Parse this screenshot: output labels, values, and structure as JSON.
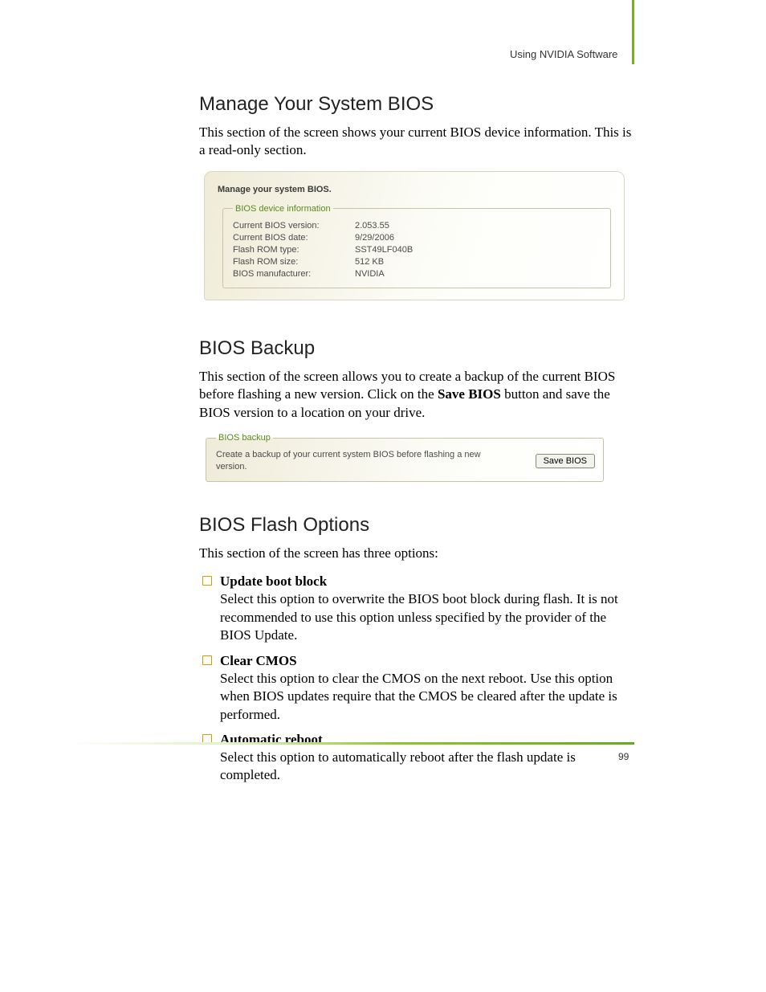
{
  "header": {
    "chapter": "Using NVIDIA Software"
  },
  "sections": {
    "manage": {
      "heading": "Manage Your System BIOS",
      "intro": "This section of the screen shows your current BIOS device information. This is a read-only section."
    },
    "backup": {
      "heading": "BIOS Backup",
      "intro_pre": "This section of the screen allows you to create a backup of the current BIOS before flashing a new version. Click on the ",
      "intro_bold": "Save BIOS",
      "intro_post": " button and save the BIOS version to a location on your drive."
    },
    "flash": {
      "heading": "BIOS Flash Options",
      "intro": "This section of the screen has three options:",
      "options": [
        {
          "title": "Update boot block",
          "body": "Select this option to overwrite the BIOS boot block during flash. It is not recommended to use this option unless specified by the provider of the BIOS Update."
        },
        {
          "title": "Clear CMOS",
          "body": "Select this option to clear the CMOS on the next reboot. Use this option when BIOS updates require that the CMOS be cleared after the update is performed."
        },
        {
          "title": "Automatic reboot",
          "body": "Select this option to automatically reboot after the flash update is completed."
        }
      ]
    }
  },
  "manage_window": {
    "title": "Manage your system BIOS.",
    "fieldset_legend": "BIOS device information",
    "rows": [
      {
        "label": "Current BIOS version:",
        "value": "2.053.55"
      },
      {
        "label": "Current BIOS date:",
        "value": "9/29/2006"
      },
      {
        "label": "Flash ROM type:",
        "value": "SST49LF040B"
      },
      {
        "label": "Flash ROM size:",
        "value": "512 KB"
      },
      {
        "label": "BIOS manufacturer:",
        "value": "NVIDIA"
      }
    ]
  },
  "backup_window": {
    "fieldset_legend": "BIOS backup",
    "text": "Create a backup of your current system BIOS before flashing a new version.",
    "button": "Save BIOS"
  },
  "footer": {
    "page_number": "99"
  }
}
